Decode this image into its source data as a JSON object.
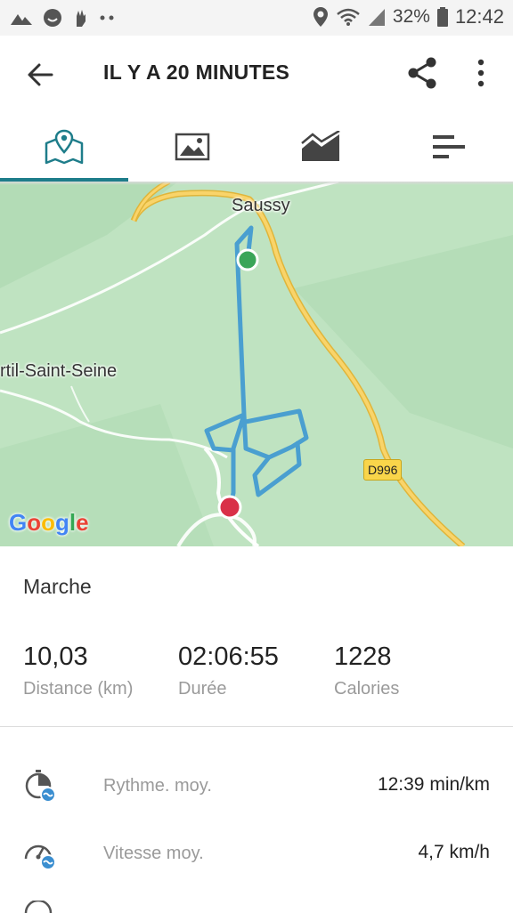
{
  "status_bar": {
    "left_icons": [
      "signal-icon",
      "smiley-icon",
      "hand-icon",
      "dots-icon"
    ],
    "battery_percent": "32%",
    "time": "12:42"
  },
  "app_bar": {
    "title": "IL Y A 20 MINUTES"
  },
  "tabs": [
    {
      "name": "map-tab",
      "icon": "map-pin-icon",
      "active": true
    },
    {
      "name": "photos-tab",
      "icon": "image-icon",
      "active": false
    },
    {
      "name": "graph-tab",
      "icon": "chart-icon",
      "active": false
    },
    {
      "name": "details-tab",
      "icon": "bars-icon",
      "active": false
    }
  ],
  "map": {
    "labels": {
      "saussy": "Saussy",
      "town": "rtil-Saint-Seine",
      "road": "D996"
    },
    "attribution": "Google"
  },
  "activity": {
    "type": "Marche",
    "stats": [
      {
        "value": "10,03",
        "label": "Distance (km)"
      },
      {
        "value": "02:06:55",
        "label": "Durée"
      },
      {
        "value": "1228",
        "label": "Calories"
      }
    ],
    "metrics": [
      {
        "label": "Rythme. moy.",
        "value": "12:39 min/km",
        "icon": "pace-icon"
      },
      {
        "label": "Vitesse moy.",
        "value": "4,7 km/h",
        "icon": "speedometer-icon"
      }
    ]
  },
  "colors": {
    "accent": "#1e7d8a",
    "track": "#4a9fd0",
    "start": "#3aa558",
    "end": "#d93048",
    "road": "#f5c84a",
    "map_bg": "#bfe3c1"
  }
}
